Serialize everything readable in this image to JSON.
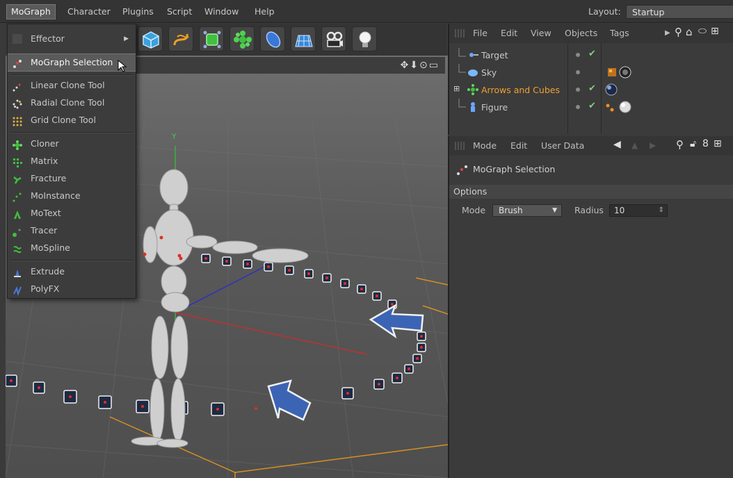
{
  "menubar": {
    "items": [
      "MoGraph",
      "Character",
      "Plugins",
      "Script",
      "Window",
      "Help"
    ],
    "layout_label": "Layout:",
    "layout_value": "Startup"
  },
  "mograph_menu": {
    "effector": "Effector",
    "mograph_selection": "MoGraph Selection",
    "linear_clone_tool": "Linear Clone Tool",
    "radial_clone_tool": "Radial Clone Tool",
    "grid_clone_tool": "Grid Clone Tool",
    "cloner": "Cloner",
    "matrix": "Matrix",
    "fracture": "Fracture",
    "moinstance": "MoInstance",
    "motext": "MoText",
    "tracer": "Tracer",
    "mospline": "MoSpline",
    "extrude": "Extrude",
    "polyfx": "PolyFX"
  },
  "toolbar_icons": [
    "cube-icon",
    "spline-icon",
    "nurbs-icon",
    "array-icon",
    "deformer-icon",
    "floor-icon",
    "camera-icon",
    "light-icon"
  ],
  "viewport": {
    "axis_y_label": "Y",
    "nav_icons": "✥⬇⊙▭"
  },
  "object_manager": {
    "menu": [
      "File",
      "Edit",
      "View",
      "Objects",
      "Tags"
    ],
    "objects": [
      {
        "name": "Target",
        "highlight": false
      },
      {
        "name": "Sky",
        "highlight": false
      },
      {
        "name": "Arrows and Cubes",
        "highlight": true
      },
      {
        "name": "Figure",
        "highlight": false
      }
    ],
    "highlight_color": "#f0a030"
  },
  "attribute_manager": {
    "menu": [
      "Mode",
      "Edit",
      "User Data"
    ],
    "title": "MoGraph Selection",
    "section": "Options",
    "mode_label": "Mode",
    "mode_value": "Brush",
    "radius_label": "Radius",
    "radius_value": "10"
  }
}
